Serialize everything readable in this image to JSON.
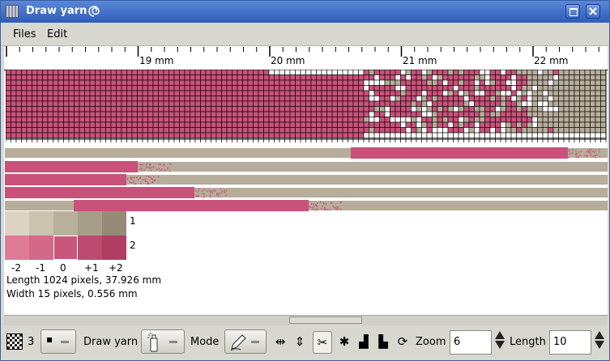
{
  "window": {
    "title": "Draw yarn"
  },
  "menu": {
    "files": "Files",
    "edit": "Edit"
  },
  "ruler": {
    "labels": [
      "19 mm",
      "20 mm",
      "21 mm",
      "22 mm"
    ]
  },
  "shades": {
    "row1_label": "1",
    "row2_label": "2",
    "offsets": [
      "-2",
      "-1",
      "0",
      "+1",
      "+2"
    ],
    "row1_colors": [
      "#dcd3c3",
      "#cbc2b0",
      "#b9b09c",
      "#a79e8a",
      "#958b76"
    ],
    "row2_colors": [
      "#e07a97",
      "#d46889",
      "#c9577c",
      "#bd4a70",
      "#b03e63"
    ]
  },
  "status": {
    "length": "Length 1024 pixels, 37.926 mm",
    "width": "Width 15 pixels, 0.556 mm"
  },
  "colors": {
    "yarn_pink": "#c8527a",
    "yarn_beige": "#b7ad9b",
    "title_blue": "#3a66c0"
  },
  "toolbar": {
    "count": "3",
    "draw_yarn_label": "Draw yarn",
    "mode_label": "Mode",
    "zoom_label": "Zoom",
    "zoom_value": "6",
    "length_label": "Length",
    "length_value": "10"
  }
}
